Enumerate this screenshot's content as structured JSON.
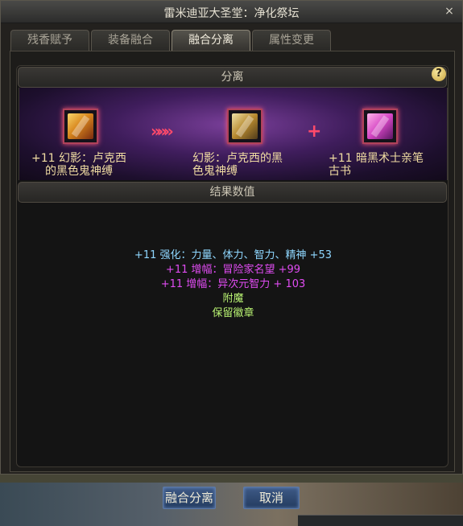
{
  "window": {
    "title": "雷米迪亚大圣堂：净化祭坛",
    "close_symbol": "×"
  },
  "tabs": [
    {
      "label": "残香赋予",
      "active": false
    },
    {
      "label": "装备融合",
      "active": false
    },
    {
      "label": "融合分离",
      "active": true
    },
    {
      "label": "属性变更",
      "active": false
    }
  ],
  "separation": {
    "header": "分离",
    "help_symbol": "?",
    "source_item": {
      "name_line1": "+11 幻影：卢克西",
      "name_line2": "的黑色鬼神缚"
    },
    "arrow_symbol": "»»»",
    "result_item": {
      "name_line1": "幻影：卢克西的黑",
      "name_line2": "色鬼神缚"
    },
    "plus_symbol": "+",
    "extra_item": {
      "name_line1": "+11 暗黑术士亲笔",
      "name_line2": "古书"
    }
  },
  "result_values": {
    "header": "结果数值",
    "lines": [
      "+11 强化：力量、体力、智力、精神 +53",
      "+11 增幅：冒险家名望 +99",
      "+11 增幅：异次元智力 + 103",
      "附魔",
      "保留徽章"
    ]
  },
  "buttons": {
    "confirm": "融合分离",
    "cancel": "取消"
  },
  "colors": {
    "enhance": "#8fd7ff",
    "amplify": "#e04cf2",
    "misc": "#b8f272",
    "item_name": "#f0dca2"
  }
}
